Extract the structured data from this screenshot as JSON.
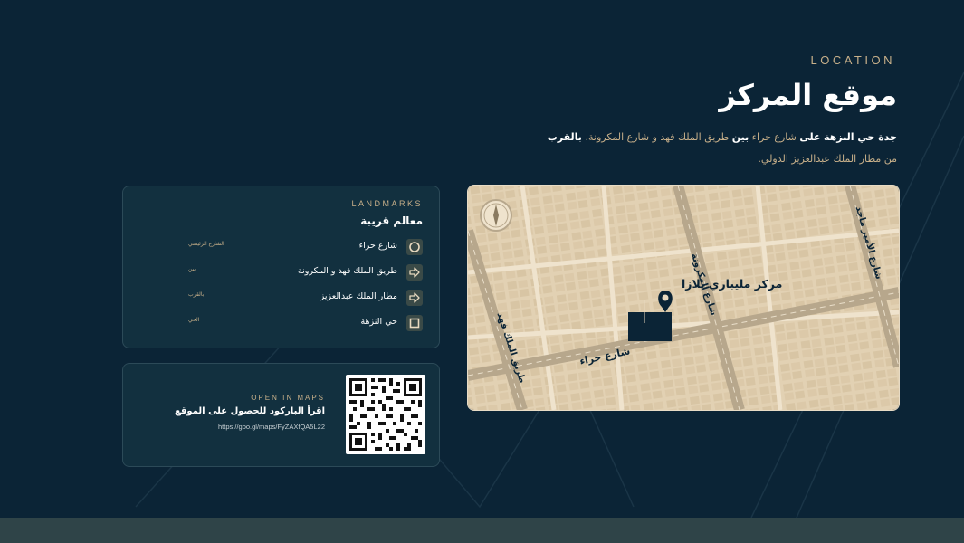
{
  "header": {
    "eyebrow": "LOCATION",
    "title": "موقع المركز",
    "desc_line1": {
      "part1": "جدة حي النزهة",
      "part2": "على",
      "part3": "شارع حراء",
      "part4": "بين",
      "part5": "طريق الملك فهد و شارع المكرونة،",
      "part6": "بالقرب"
    },
    "desc_line2": "من مطار الملك عبدالعزيز الدولي."
  },
  "landmarks": {
    "eyebrow": "LANDMARKS",
    "title": "معالم قريبة",
    "items": [
      {
        "label": "شارع حراء",
        "note": "الشارع الرئيسي",
        "icon": "circle-icon"
      },
      {
        "label": "طريق الملك فهد و المكرونة",
        "note": "بين",
        "icon": "arrow-right-icon"
      },
      {
        "label": "مطار الملك عبدالعزيز",
        "note": "بالقرب",
        "icon": "arrow-right-icon"
      },
      {
        "label": "حي النزهة",
        "note": "الحي",
        "icon": "square-icon"
      }
    ]
  },
  "qr_card": {
    "eyebrow": "OPEN IN MAPS",
    "title": "اقرأ الباركود للحصول على الموقع",
    "url": "https://goo.gl/maps/FyZAXfQA5L22"
  },
  "map": {
    "place_label": "مركز مليباري بلازا",
    "street_hiraa": "شارع حراء",
    "street_king_fahd": "طريق الملك فهد",
    "street_makarona": "شارع المكرونة",
    "street_prince_majid": "شارع الأمير ماجد",
    "compass": "compass-icon",
    "pin": "location-pin-icon"
  },
  "colors": {
    "background": "#0b2436",
    "accent": "#c8b08a",
    "card": "#12303f",
    "map_land": "#e8d9bf",
    "map_road": "#b7a78c",
    "footer": "#2f4448"
  }
}
